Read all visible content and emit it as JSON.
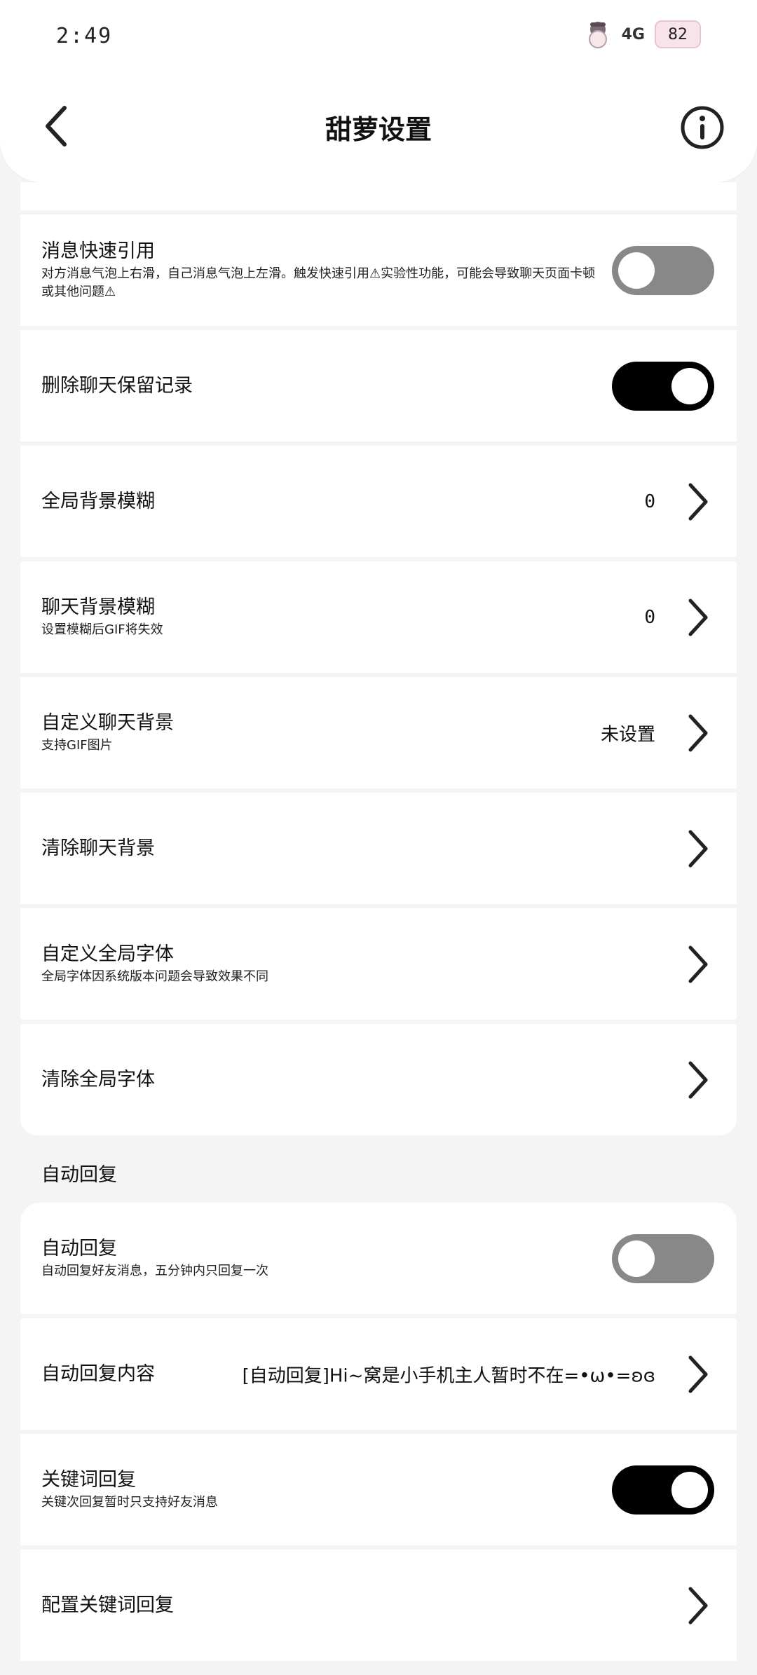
{
  "status_bar": {
    "time": "2:49",
    "network": "4G",
    "battery": "82"
  },
  "header": {
    "title": "甜萝设置"
  },
  "items": [
    {
      "title": "消息快速引用",
      "subtitle": "对方消息气泡上右滑，自己消息气泡上左滑。触发快速引用⚠实验性功能，可能会导致聊天页面卡顿或其他问题⚠",
      "control": "toggle",
      "state": "off"
    },
    {
      "title": "删除聊天保留记录",
      "control": "toggle",
      "state": "on"
    },
    {
      "title": "全局背景模糊",
      "value": "0",
      "control": "chevron"
    },
    {
      "title": "聊天背景模糊",
      "subtitle": "设置模糊后GIF将失效",
      "value": "0",
      "control": "chevron"
    },
    {
      "title": "自定义聊天背景",
      "subtitle": "支持GIF图片",
      "value": "未设置",
      "control": "chevron"
    },
    {
      "title": "清除聊天背景",
      "control": "chevron"
    },
    {
      "title": "自定义全局字体",
      "subtitle": "全局字体因系统版本问题会导致效果不同",
      "control": "chevron"
    },
    {
      "title": "清除全局字体",
      "control": "chevron"
    }
  ],
  "section_auto_reply": {
    "header": "自动回复",
    "items": [
      {
        "title": "自动回复",
        "subtitle": "自动回复好友消息，五分钟内只回复一次",
        "control": "toggle",
        "state": "off"
      },
      {
        "title": "自动回复内容",
        "value": "[自动回复]Hi~窝是小手机主人暂时不在=•ω•=ʚɞ",
        "control": "chevron"
      },
      {
        "title": "关键词回复",
        "subtitle": "关键次回复暂时只支持好友消息",
        "control": "toggle",
        "state": "on"
      },
      {
        "title": "配置关键词回复",
        "control": "chevron"
      }
    ]
  },
  "colors": {
    "toggle_on": "#000000",
    "toggle_off": "#888888",
    "background": "#f4f4f4",
    "card": "#ffffff"
  }
}
